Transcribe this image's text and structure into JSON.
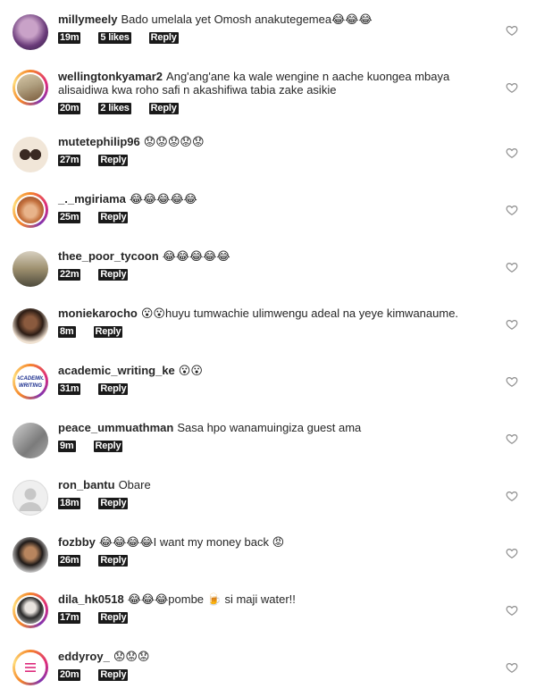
{
  "comments": [
    {
      "user": "millymeely",
      "text": "Bado umelala yet Omosh anakutegemea😂😂😂",
      "time": "19m",
      "likes": "5 likes",
      "reply": "Reply"
    },
    {
      "user": "wellingtonkyamar2",
      "text": "Ang'ang'ane ka wale wengine n aache kuongea mbaya alisaidiwa kwa roho safi n akashifiwa tabia zake asikie",
      "time": "20m",
      "likes": "2 likes",
      "reply": "Reply"
    },
    {
      "user": "mutetephilip96",
      "text": "😟😟😟😟😟",
      "time": "27m",
      "likes": "",
      "reply": "Reply"
    },
    {
      "user": "_._mgiriama",
      "text": "😂😂😂😂😂",
      "time": "25m",
      "likes": "",
      "reply": "Reply"
    },
    {
      "user": "thee_poor_tycoon",
      "text": "😂😂😂😂😂",
      "time": "22m",
      "likes": "",
      "reply": "Reply"
    },
    {
      "user": "moniekarocho",
      "text": "😮😮huyu tumwachie ulimwengu adeal na yeye kimwanaume.",
      "time": "8m",
      "likes": "",
      "reply": "Reply"
    },
    {
      "user": "academic_writing_ke",
      "text": "😮😮",
      "time": "31m",
      "likes": "",
      "reply": "Reply"
    },
    {
      "user": "peace_ummuathman",
      "text": "Sasa hpo wanamuingiza guest ama",
      "time": "9m",
      "likes": "",
      "reply": "Reply"
    },
    {
      "user": "ron_bantu",
      "text": "Obare",
      "time": "18m",
      "likes": "",
      "reply": "Reply"
    },
    {
      "user": "fozbby",
      "text": "😂😂😂😂I want my money back 😡",
      "time": "26m",
      "likes": "",
      "reply": "Reply"
    },
    {
      "user": "dila_hk0518",
      "text": "😂😂😂pombe 🍺 si maji water!!",
      "time": "17m",
      "likes": "",
      "reply": "Reply"
    },
    {
      "user": "eddyroy_",
      "text": "😟😟😟",
      "time": "20m",
      "likes": "",
      "reply": "Reply"
    }
  ],
  "avatar_badge_text": "ACADEMIC WRITING",
  "icons": {
    "like": "heart-outline-icon",
    "menu": "hamburger-menu-icon"
  },
  "colors": {
    "text": "#262626",
    "story_ring": "#dd2a7b",
    "badge_bg": "#1a1a1a",
    "heart": "#8e8e8e"
  }
}
